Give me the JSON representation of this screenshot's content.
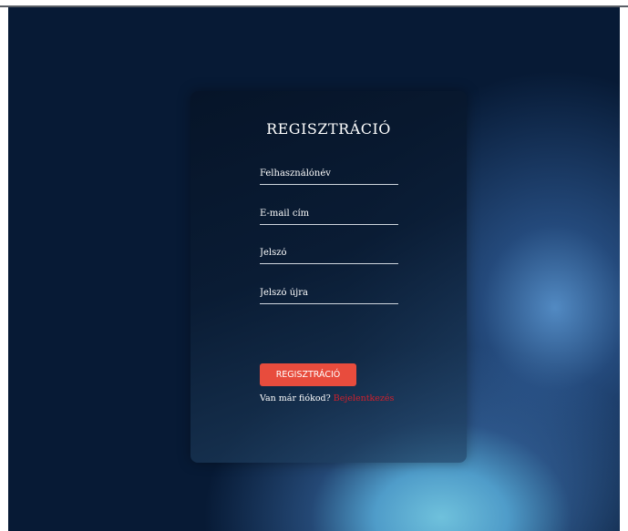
{
  "form": {
    "title": "REGISZTRÁCIÓ",
    "fields": [
      {
        "placeholder": "Felhasználónév"
      },
      {
        "placeholder": "E-mail cím"
      },
      {
        "placeholder": "Jelszó"
      },
      {
        "placeholder": "Jelszó újra"
      }
    ],
    "submit_label": "REGISZTRÁCIÓ",
    "footer_text": "Van már fiókod?",
    "login_link": "Bejelentkezés"
  },
  "colors": {
    "accent": "#e84c3d",
    "link": "#d1202c",
    "background": "#071a35"
  }
}
